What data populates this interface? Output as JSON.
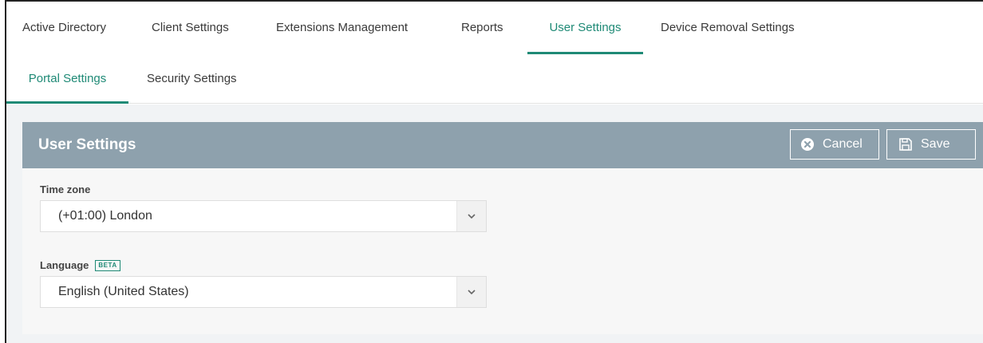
{
  "top_tabs": [
    {
      "label": "Active Directory"
    },
    {
      "label": "Client Settings"
    },
    {
      "label": "Extensions Management"
    },
    {
      "label": "Reports"
    },
    {
      "label": "User Settings",
      "active": true
    },
    {
      "label": "Device Removal Settings"
    }
  ],
  "sub_tabs": [
    {
      "label": "Portal Settings",
      "active": true
    },
    {
      "label": "Security Settings"
    }
  ],
  "panel": {
    "title": "User Settings",
    "cancel_label": "Cancel",
    "save_label": "Save"
  },
  "fields": {
    "timezone": {
      "label": "Time zone",
      "value": "(+01:00) London"
    },
    "language": {
      "label": "Language",
      "badge": "BETA",
      "value": "English (United States)"
    }
  },
  "colors": {
    "accent": "#1f8a76",
    "header_bg": "#8ea1ad"
  }
}
